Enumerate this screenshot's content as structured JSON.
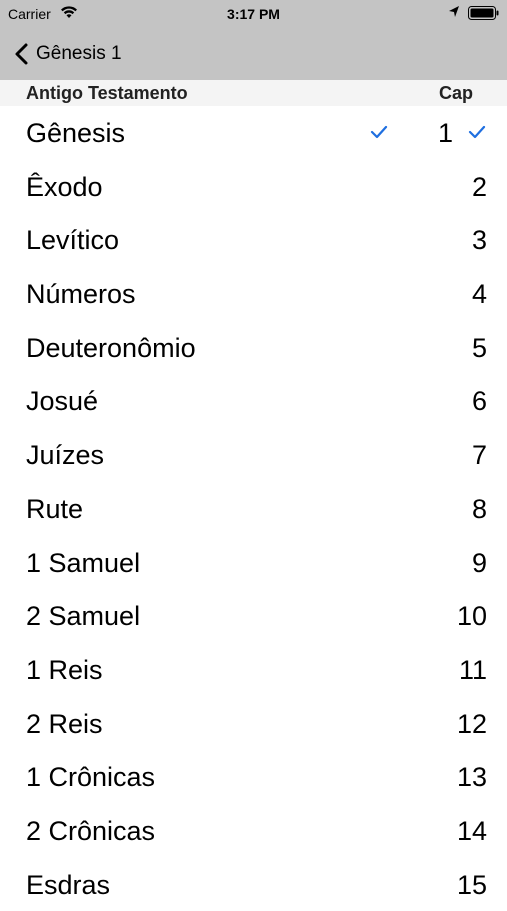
{
  "status_bar": {
    "carrier": "Carrier",
    "time": "3:17 PM",
    "icons": [
      "wifi-icon",
      "location-arrow-icon",
      "battery-icon"
    ]
  },
  "nav": {
    "back_label": "Gênesis 1",
    "back_icon": "chevron-left-icon"
  },
  "section": {
    "title": "Antigo Testamento",
    "right_label": "Cap"
  },
  "colors": {
    "accent": "#1f6fe0",
    "bar_bg": "#c4c4c4",
    "header_bg": "#f4f4f4"
  },
  "books": [
    {
      "name": "Gênesis",
      "number": "1",
      "selected": true
    },
    {
      "name": "Êxodo",
      "number": "2"
    },
    {
      "name": "Levítico",
      "number": "3"
    },
    {
      "name": "Números",
      "number": "4"
    },
    {
      "name": "Deuteronômio",
      "number": "5"
    },
    {
      "name": "Josué",
      "number": "6"
    },
    {
      "name": "Juízes",
      "number": "7"
    },
    {
      "name": "Rute",
      "number": "8"
    },
    {
      "name": "1 Samuel",
      "number": "9"
    },
    {
      "name": "2 Samuel",
      "number": "10"
    },
    {
      "name": "1 Reis",
      "number": "11"
    },
    {
      "name": "2 Reis",
      "number": "12"
    },
    {
      "name": "1 Crônicas",
      "number": "13"
    },
    {
      "name": "2 Crônicas",
      "number": "14"
    },
    {
      "name": "Esdras",
      "number": "15"
    }
  ]
}
